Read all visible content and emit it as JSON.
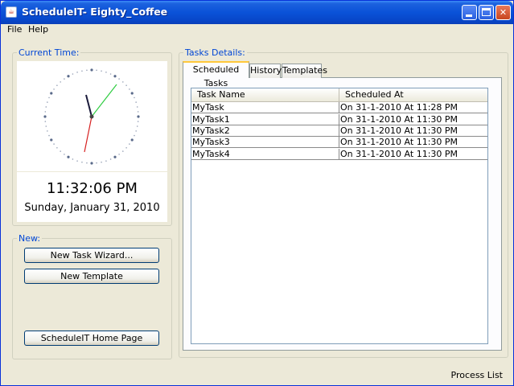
{
  "window": {
    "title": "ScheduleIT- Eighty_Coffee"
  },
  "menu": {
    "file": "File",
    "help": "Help"
  },
  "clock_group": {
    "title": "Current Time:",
    "time": "11:32:06 PM",
    "date": "Sunday, January 31, 2010"
  },
  "new_group": {
    "title": "New:",
    "new_task_wizard": "New Task Wizard...",
    "new_template": "New Template",
    "home_page": "ScheduleIT Home Page"
  },
  "tasks_group": {
    "title": "Tasks Details:",
    "tabs": [
      {
        "label": "Scheduled Tasks",
        "active": true
      },
      {
        "label": "History",
        "active": false
      },
      {
        "label": "Templates",
        "active": false
      }
    ],
    "columns": [
      "Task Name",
      "Scheduled At"
    ],
    "rows": [
      [
        "MyTask",
        "On 31-1-2010 At 11:28 PM"
      ],
      [
        "MyTask1",
        "On 31-1-2010 At 11:30 PM"
      ],
      [
        "MyTask2",
        "On 31-1-2010 At 11:30 PM"
      ],
      [
        "MyTask3",
        "On 31-1-2010 At 11:30 PM"
      ],
      [
        "MyTask4",
        "On 31-1-2010 At 11:30 PM"
      ]
    ]
  },
  "status": {
    "process_list": "Process List"
  },
  "colors": {
    "group_title": "#0046d5",
    "titlebar": "#0a52d8",
    "background": "#ece9d8"
  }
}
